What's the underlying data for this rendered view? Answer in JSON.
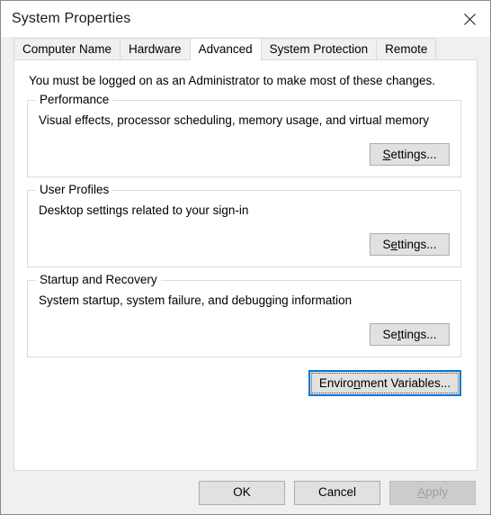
{
  "window": {
    "title": "System Properties",
    "close_icon": "close-icon"
  },
  "tabs": [
    {
      "label": "Computer Name",
      "active": false
    },
    {
      "label": "Hardware",
      "active": false
    },
    {
      "label": "Advanced",
      "active": true
    },
    {
      "label": "System Protection",
      "active": false
    },
    {
      "label": "Remote",
      "active": false
    }
  ],
  "page": {
    "notice": "You must be logged on as an Administrator to make most of these changes.",
    "groups": [
      {
        "legend": "Performance",
        "description": "Visual effects, processor scheduling, memory usage, and virtual memory",
        "button": {
          "label": "Settings...",
          "accel_before": "",
          "accel_char": "S",
          "accel_after": "ettings..."
        }
      },
      {
        "legend": "User Profiles",
        "description": "Desktop settings related to your sign-in",
        "button": {
          "label": "Settings...",
          "accel_before": "S",
          "accel_char": "e",
          "accel_after": "ttings..."
        }
      },
      {
        "legend": "Startup and Recovery",
        "description": "System startup, system failure, and debugging information",
        "button": {
          "label": "Settings...",
          "accel_before": "Se",
          "accel_char": "t",
          "accel_after": "tings..."
        }
      }
    ],
    "environment_button": {
      "label": "Environment Variables...",
      "accel_before": "Enviro",
      "accel_char": "n",
      "accel_after": "ment Variables...",
      "focused": true
    }
  },
  "footer": {
    "ok": {
      "label": "OK"
    },
    "cancel": {
      "label": "Cancel"
    },
    "apply": {
      "label": "Apply",
      "accel_before": "",
      "accel_char": "A",
      "accel_after": "pply",
      "disabled": true
    }
  },
  "colors": {
    "accent_focus": "#0078d7",
    "window_bg": "#f0f0f0",
    "page_bg": "#ffffff",
    "button_face": "#e1e1e1",
    "button_border": "#adadad",
    "disabled_text": "#a0a0a0"
  }
}
